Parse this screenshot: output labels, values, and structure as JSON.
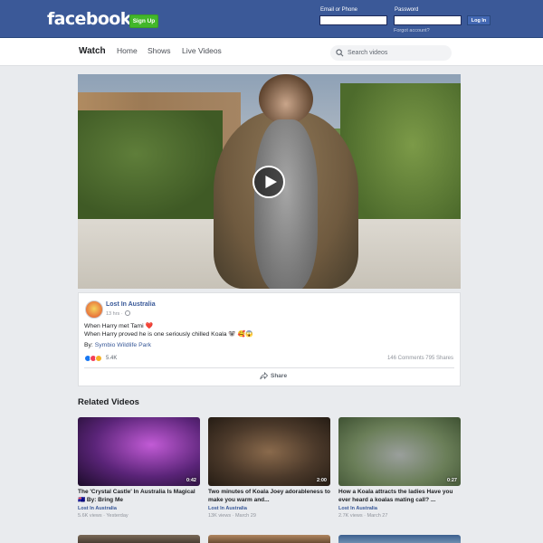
{
  "topbar": {
    "logo": "facebook",
    "signup_label": "Sign Up",
    "email_label": "Email or Phone",
    "password_label": "Password",
    "login_label": "Log In",
    "forgot_label": "Forgot account?"
  },
  "nav": {
    "watch": "Watch",
    "home": "Home",
    "shows": "Shows",
    "live": "Live Videos",
    "search_placeholder": "Search videos"
  },
  "video": {
    "play_icon": "play-icon"
  },
  "post": {
    "page_name": "Lost In Australia",
    "time": "13 hrs ·",
    "line1": "When Harry met Tami ❤️",
    "line2": "When Harry proved he is one seriously chilled Koala 🐨 🥰😱",
    "by_prefix": "By: ",
    "by_link": "Symbio Wildlife Park",
    "reaction_count": "5.4K",
    "stats": "146 Comments  795 Shares",
    "share_label": "Share"
  },
  "related": {
    "title": "Related Videos",
    "items": [
      {
        "duration": "0:42",
        "title": "The 'Crystal Castle' In Australia Is Magical 🇦🇺 By: Bring Me",
        "page": "Lost In Australia",
        "meta": "5.6K views · Yesterday"
      },
      {
        "duration": "2:00",
        "title": "Two minutes of Koala Joey adorableness to make you warm and...",
        "page": "Lost In Australia",
        "meta": "13K views · March 29"
      },
      {
        "duration": "0:27",
        "title": "How a Koala attracts the ladies Have you ever heard a koalas mating call? ...",
        "page": "Lost In Australia",
        "meta": "2.7K views · March 27"
      }
    ]
  },
  "colors": {
    "brand_blue": "#3b5998",
    "signup_green": "#42b72a",
    "link_blue": "#385898"
  }
}
